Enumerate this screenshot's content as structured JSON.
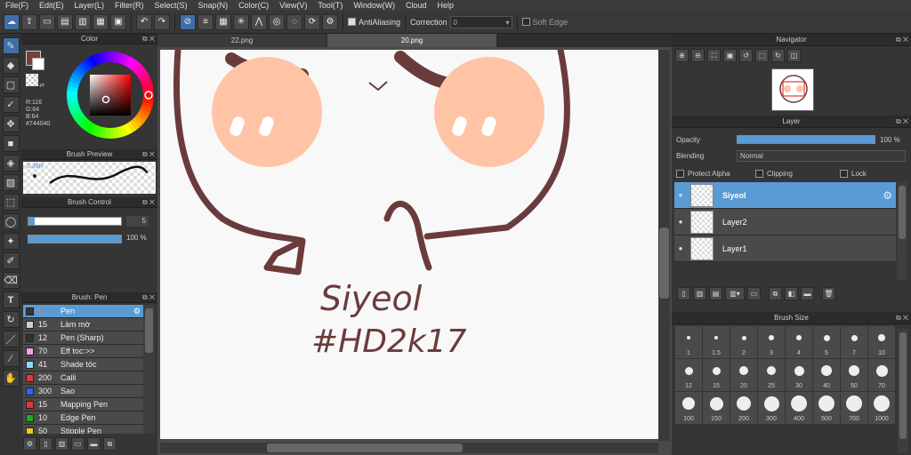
{
  "menu": [
    "File(F)",
    "Edit(E)",
    "Layer(L)",
    "Filter(R)",
    "Select(S)",
    "Snap(N)",
    "Color(C)",
    "View(V)",
    "Tool(T)",
    "Window(W)",
    "Cloud",
    "Help"
  ],
  "toolbar": {
    "antialiasing_label": "AntiAliasing",
    "correction_label": "Correction",
    "correction_value": "0",
    "soft_edge_label": "Soft Edge"
  },
  "color_panel": {
    "title": "Color",
    "r": "R:116",
    "g": "G:64",
    "b": "B:64",
    "hex": "#744040",
    "main_color": "#744040"
  },
  "brush_preview": {
    "title": "Brush Preview",
    "size_label": "0.36R"
  },
  "brush_control": {
    "title": "Brush Control",
    "size": "5",
    "opacity": "100 %",
    "opacity_value": 1.0
  },
  "brush_list": {
    "title": "Brush: Pen",
    "items": [
      {
        "size": "5",
        "name": "Pen",
        "color": "#333333"
      },
      {
        "size": "15",
        "name": "Làm mờ",
        "color": "#cccccc"
      },
      {
        "size": "12",
        "name": "Pen (Sharp)",
        "color": "#333333"
      },
      {
        "size": "70",
        "name": "Eff toc:>>",
        "color": "#f5a0e6"
      },
      {
        "size": "41",
        "name": "Shade tóc",
        "color": "#88ddff"
      },
      {
        "size": "200",
        "name": "Calli",
        "color": "#ee3333"
      },
      {
        "size": "300",
        "name": "Sao",
        "color": "#3366ee"
      },
      {
        "size": "15",
        "name": "Mapping Pen",
        "color": "#ee3333"
      },
      {
        "size": "10",
        "name": "Edge Pen",
        "color": "#22aa22"
      },
      {
        "size": "50",
        "name": "Stipple Pen",
        "color": "#eecc22"
      }
    ]
  },
  "tabs": [
    "22.png",
    "20.png"
  ],
  "canvas": {
    "handwriting_line1": "Siyeol",
    "handwriting_line2": "#HD2k17"
  },
  "navigator": {
    "title": "Navigator"
  },
  "layer_panel": {
    "title": "Layer",
    "opacity_label": "Opacity",
    "opacity": "100 %",
    "opacity_value": 1.0,
    "blending_label": "Blending",
    "blending_value": "Normal",
    "protect_alpha": "Protect Alpha",
    "clipping": "Clipping",
    "lock": "Lock",
    "layers": [
      {
        "name": "Siyeol"
      },
      {
        "name": "Layer2"
      },
      {
        "name": "Layer1"
      }
    ]
  },
  "brush_size": {
    "title": "Brush Size",
    "sizes": [
      "1",
      "1.5",
      "2",
      "3",
      "4",
      "5",
      "7",
      "10",
      "12",
      "15",
      "20",
      "25",
      "30",
      "40",
      "50",
      "70",
      "100",
      "150",
      "200",
      "300",
      "400",
      "500",
      "700",
      "1000"
    ]
  },
  "colors": {
    "accent": "#5a9bd5",
    "brown": "#6b3b3b",
    "blush": "#ffc4a6"
  }
}
